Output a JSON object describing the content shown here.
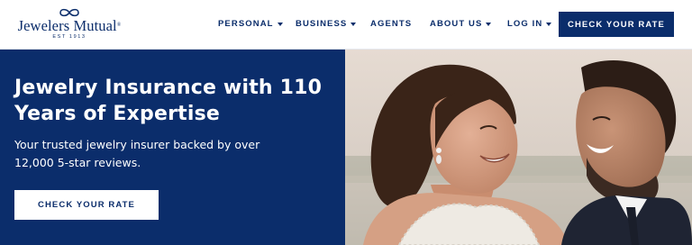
{
  "brand": {
    "name": "Jewelers Mutual",
    "trademark": "®",
    "established": "EST 1913"
  },
  "nav": {
    "items": [
      {
        "label": "PERSONAL",
        "dropdown": true
      },
      {
        "label": "BUSINESS",
        "dropdown": true
      },
      {
        "label": "AGENTS",
        "dropdown": false
      },
      {
        "label": "ABOUT US",
        "dropdown": true
      },
      {
        "label": "LOG IN",
        "dropdown": true
      }
    ],
    "cta_label": "CHECK YOUR RATE"
  },
  "hero": {
    "title": "Jewelry Insurance with 110 Years of Expertise",
    "subtitle": "Your trusted jewelry insurer backed by over 12,000 5-star reviews.",
    "cta_label": "CHECK YOUR RATE",
    "image": "couple-smiling-photo"
  },
  "colors": {
    "brand_navy": "#0b2d6b",
    "white": "#ffffff"
  }
}
